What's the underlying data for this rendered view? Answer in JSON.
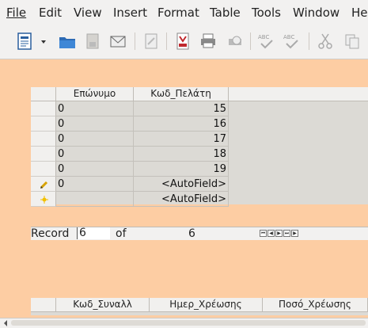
{
  "menu": {
    "file": "File",
    "edit": "Edit",
    "view": "View",
    "insert": "Insert",
    "format": "Format",
    "table": "Table",
    "tools": "Tools",
    "window": "Window",
    "help": "He"
  },
  "toolbar_icons": [
    "new-document-icon",
    "new-dropdown-icon",
    "open-folder-icon",
    "save-icon",
    "email-icon",
    "edit-file-icon",
    "export-pdf-icon",
    "print-icon",
    "print-preview-icon",
    "spellcheck-icon",
    "autospellcheck-icon",
    "cut-icon",
    "copy-icon"
  ],
  "table": {
    "headers": [
      "Επώνυμο",
      "Κωδ_Πελάτη"
    ],
    "rows": [
      {
        "surname": "0",
        "code": "15"
      },
      {
        "surname": "0",
        "code": "16"
      },
      {
        "surname": "0",
        "code": "17"
      },
      {
        "surname": "0",
        "code": "18"
      },
      {
        "surname": "0",
        "code": "19"
      },
      {
        "surname": "0",
        "code": "<AutoField>"
      },
      {
        "surname": "",
        "code": "<AutoField>"
      }
    ]
  },
  "navigation": {
    "record_label": "Record",
    "record_value": "6",
    "of_label": "of",
    "total": "6"
  },
  "table2": {
    "headers": [
      "Κωδ_Συναλλ",
      "Ημερ_Χρέωσης",
      "Ποσό_Χρέωσης"
    ]
  },
  "colors": {
    "background": "#fdcda3",
    "grid": "#dcdad5"
  }
}
